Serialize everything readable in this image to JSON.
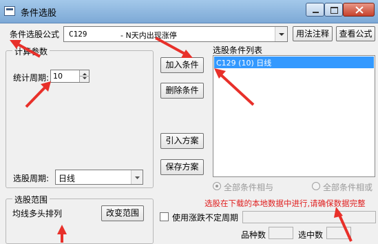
{
  "window": {
    "title": "条件选股"
  },
  "formula": {
    "label": "条件选股公式",
    "code": "C129",
    "description": "- N天内出现涨停",
    "help_button": "用法注释",
    "view_button": "查看公式"
  },
  "params": {
    "group_title": "计算参数",
    "period_label": "统计周期:",
    "period_value": "10"
  },
  "select_period": {
    "label": "选股周期:",
    "value": "日线"
  },
  "actions": {
    "add": "加入条件",
    "delete": "删除条件",
    "import": "引入方案",
    "save": "保存方案"
  },
  "conditions": {
    "title": "选股条件列表",
    "items": [
      {
        "text": "C129 (10) 日线"
      }
    ]
  },
  "logic": {
    "all_and": "全部条件相与",
    "all_or": "全部条件相或"
  },
  "notice": "选股在下载的本地数据中进行,请确保数据完整",
  "range": {
    "group_title": "选股范围",
    "value": "均线多头排列",
    "change_button": "改变范围"
  },
  "options": {
    "undetermined_period": "使用涨跌不定周期"
  },
  "stats": {
    "total_label": "品种数",
    "selected_label": "选中数"
  },
  "colors": {
    "annotation_arrow": "#e8302a",
    "notice_text": "#e02020",
    "selection": "#3399ff"
  }
}
